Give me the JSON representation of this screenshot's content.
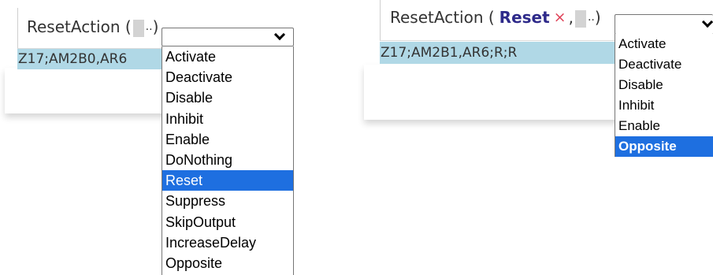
{
  "left": {
    "expr_func": "ResetAction (",
    "expr_ellipsis": "..",
    "expr_close": ")",
    "code": "Z17;AM2B0,AR6",
    "dropdown_options": [
      "Activate",
      "Deactivate",
      "Disable",
      "Inhibit",
      "Enable",
      "DoNothing",
      "Reset",
      "Suppress",
      "SkipOutput",
      "IncreaseDelay",
      "Opposite"
    ],
    "selected": "Reset"
  },
  "right": {
    "expr_func": "ResetAction (",
    "token": "Reset",
    "remove_glyph": "×",
    "comma": ",",
    "expr_ellipsis": "..",
    "expr_close": ")",
    "code": "Z17;AM2B1,AR6;R;R",
    "dropdown_options": [
      "Activate",
      "Deactivate",
      "Disable",
      "Inhibit",
      "Enable",
      "Opposite"
    ],
    "selected": "Opposite"
  },
  "colors": {
    "selection_blue": "#1e6fe0",
    "code_highlight": "#b0d8e6",
    "token_color": "#2e2a8a",
    "remove_color": "#e0445a"
  }
}
